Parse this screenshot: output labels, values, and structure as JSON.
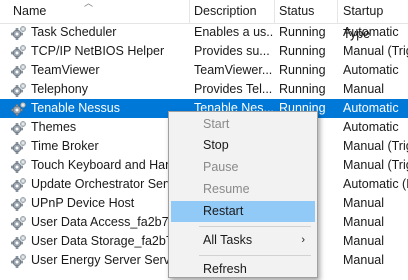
{
  "columns": {
    "name": "Name",
    "description": "Description",
    "status": "Status",
    "startup_type": "Startup Type"
  },
  "rows": [
    {
      "name": "Task Scheduler",
      "description": "Enables a us...",
      "status": "Running",
      "startup": "Automatic"
    },
    {
      "name": "TCP/IP NetBIOS Helper",
      "description": "Provides su...",
      "status": "Running",
      "startup": "Manual (Trig"
    },
    {
      "name": "TeamViewer",
      "description": "TeamViewer...",
      "status": "Running",
      "startup": "Automatic"
    },
    {
      "name": "Telephony",
      "description": "Provides Tel...",
      "status": "Running",
      "startup": "Manual"
    },
    {
      "name": "Tenable Nessus",
      "description": "Tenable Nes...",
      "status": "Running",
      "startup": "Automatic",
      "selected": true
    },
    {
      "name": "Themes",
      "description": "",
      "status": "",
      "startup": "Automatic"
    },
    {
      "name": "Time Broker",
      "description": "",
      "status": "",
      "startup": "Manual (Trig"
    },
    {
      "name": "Touch Keyboard and Hand",
      "description": "",
      "status": "",
      "startup": "Manual (Trig"
    },
    {
      "name": "Update Orchestrator Servic",
      "description": "",
      "status": "",
      "startup": "Automatic (D"
    },
    {
      "name": "UPnP Device Host",
      "description": "",
      "status": "",
      "startup": "Manual"
    },
    {
      "name": "User Data Access_fa2b7",
      "description": "",
      "status": "",
      "startup": "Manual"
    },
    {
      "name": "User Data Storage_fa2b7",
      "description": "",
      "status": "",
      "startup": "Manual"
    },
    {
      "name": "User Energy Server Service",
      "description": "",
      "status": "",
      "startup": "Manual"
    }
  ],
  "context_menu": {
    "start": "Start",
    "stop": "Stop",
    "pause": "Pause",
    "resume": "Resume",
    "restart": "Restart",
    "all_tasks": "All Tasks",
    "all_tasks_arrow": "›",
    "refresh": "Refresh"
  },
  "colors": {
    "selection": "#0078d7",
    "menu_highlight": "#91c9f7",
    "menu_background": "#f2f2f2"
  },
  "icons": {
    "service": "gear-icon",
    "sort": "sort-ascending-icon",
    "submenu": "chevron-right-icon"
  }
}
